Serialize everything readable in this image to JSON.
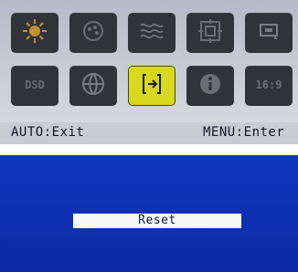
{
  "colors": {
    "top_panel": "#c9ccd2",
    "tile": "#30343a",
    "highlight": "#d8d81f",
    "bottom_panel": "#0c2aa5"
  },
  "menu_tiles": [
    {
      "icon": "brightness-icon"
    },
    {
      "icon": "color-icon"
    },
    {
      "icon": "noise-icon"
    },
    {
      "icon": "position-icon"
    },
    {
      "icon": "osd-settings-icon"
    },
    {
      "icon": "dsd-icon",
      "label": "DSD"
    },
    {
      "icon": "language-icon"
    },
    {
      "icon": "reset-icon",
      "highlighted": true
    },
    {
      "icon": "information-icon"
    },
    {
      "icon": "aspect-ratio-icon",
      "label": "16:9"
    }
  ],
  "footer": {
    "auto_hint": "AUTO:Exit",
    "menu_hint": "MENU:Enter"
  },
  "submenu": {
    "selected_item": "Reset"
  }
}
